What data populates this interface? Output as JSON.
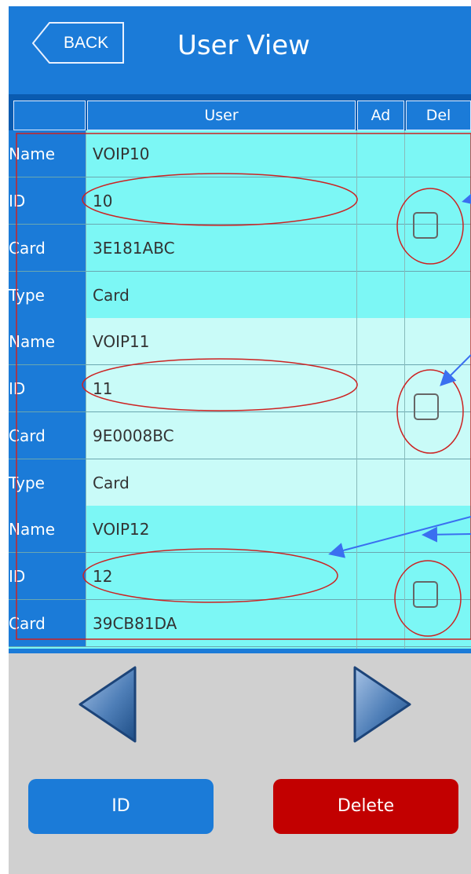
{
  "header": {
    "back_label": "BACK",
    "title": "User View"
  },
  "table": {
    "columns": [
      "",
      "User",
      "Ad",
      "Del"
    ],
    "records": [
      {
        "fields": [
          {
            "label": "Name",
            "value": "VOIP10"
          },
          {
            "label": "ID",
            "value": "10"
          },
          {
            "label": "Card",
            "value": "3E181ABC"
          },
          {
            "label": "Type",
            "value": "Card"
          }
        ]
      },
      {
        "fields": [
          {
            "label": "Name",
            "value": "VOIP11"
          },
          {
            "label": "ID",
            "value": "11"
          },
          {
            "label": "Card",
            "value": "9E0008BC"
          },
          {
            "label": "Type",
            "value": "Card"
          }
        ]
      },
      {
        "fields": [
          {
            "label": "Name",
            "value": "VOIP12"
          },
          {
            "label": "ID",
            "value": "12"
          },
          {
            "label": "Card",
            "value": "39CB81DA"
          }
        ]
      }
    ]
  },
  "navigation": {
    "prev_icon": "triangle-left-icon",
    "next_icon": "triangle-right-icon"
  },
  "buttons": {
    "id_label": "ID",
    "delete_label": "Delete"
  },
  "colors": {
    "header": "#1b7bd8",
    "row_dark": "#7cf7f5",
    "row_light": "#c9fbf8",
    "delete": "#c20000",
    "annotation_red": "#cc2222",
    "annotation_blue": "#3a6ff0"
  }
}
